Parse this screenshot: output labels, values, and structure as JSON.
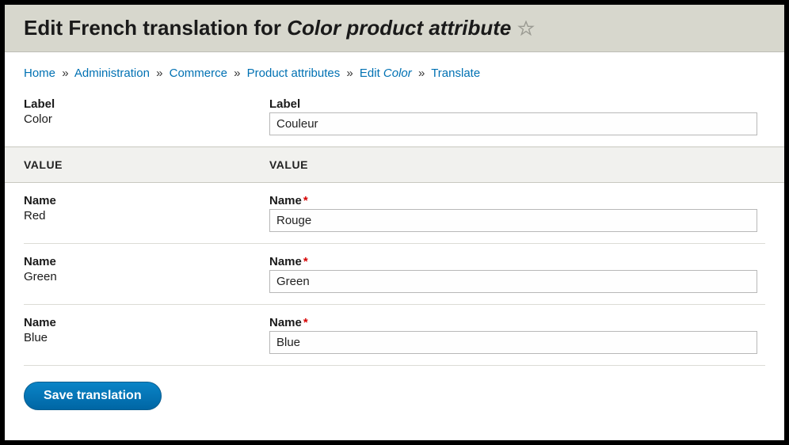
{
  "header": {
    "title_prefix": "Edit French translation for ",
    "title_em": "Color product attribute"
  },
  "breadcrumb": {
    "items": [
      {
        "label": "Home"
      },
      {
        "label": "Administration"
      },
      {
        "label": "Commerce"
      },
      {
        "label": "Product attributes"
      },
      {
        "label_prefix": "Edit ",
        "label_em": "Color"
      },
      {
        "label": "Translate"
      }
    ],
    "separator": "»"
  },
  "labels": {
    "source_field_label": "Label",
    "target_field_label": "Label",
    "source_label_value": "Color",
    "target_label_value": "Couleur",
    "values_header_left": "VALUE",
    "values_header_right": "VALUE",
    "name_label": "Name",
    "required_mark": "*"
  },
  "values": [
    {
      "source": "Red",
      "target": "Rouge"
    },
    {
      "source": "Green",
      "target": "Green"
    },
    {
      "source": "Blue",
      "target": "Blue"
    }
  ],
  "actions": {
    "save": "Save translation"
  }
}
